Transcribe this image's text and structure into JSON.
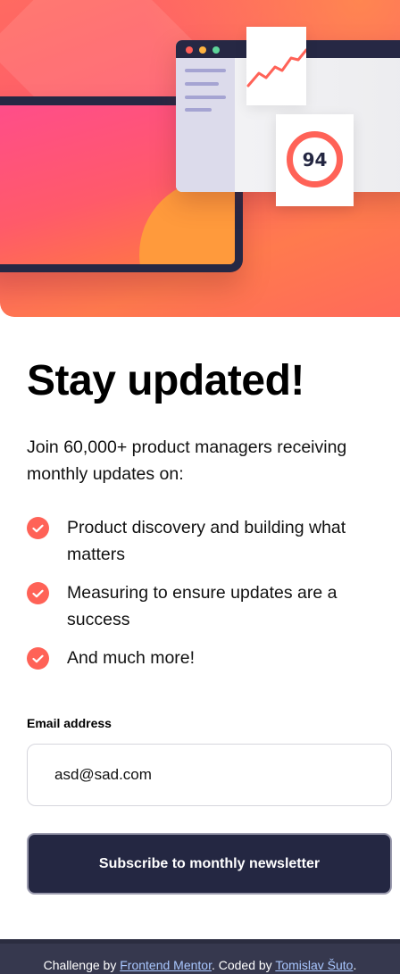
{
  "hero": {
    "score": "94",
    "icons": [
      "tablet-illustration",
      "browser-illustration",
      "trend-graph-icon",
      "score-ring-icon"
    ],
    "colors": {
      "accent": "#ff6257",
      "dark": "#242742",
      "orange": "#ff9a3c",
      "pink": "#ff4d8a"
    }
  },
  "main": {
    "title": "Stay updated!",
    "intro": "Join 60,000+ product managers receiving monthly updates on:",
    "features": [
      "Product discovery and building what matters",
      "Measuring to ensure updates are a success",
      "And much more!"
    ]
  },
  "form": {
    "email_label": "Email address",
    "email_value": "asd@sad.com",
    "submit_label": "Subscribe to monthly newsletter"
  },
  "footer": {
    "prefix": "Challenge by ",
    "link1": "Frontend Mentor",
    "middle": ". Coded by ",
    "link2": "Tomislav Šuto",
    "suffix": "."
  }
}
